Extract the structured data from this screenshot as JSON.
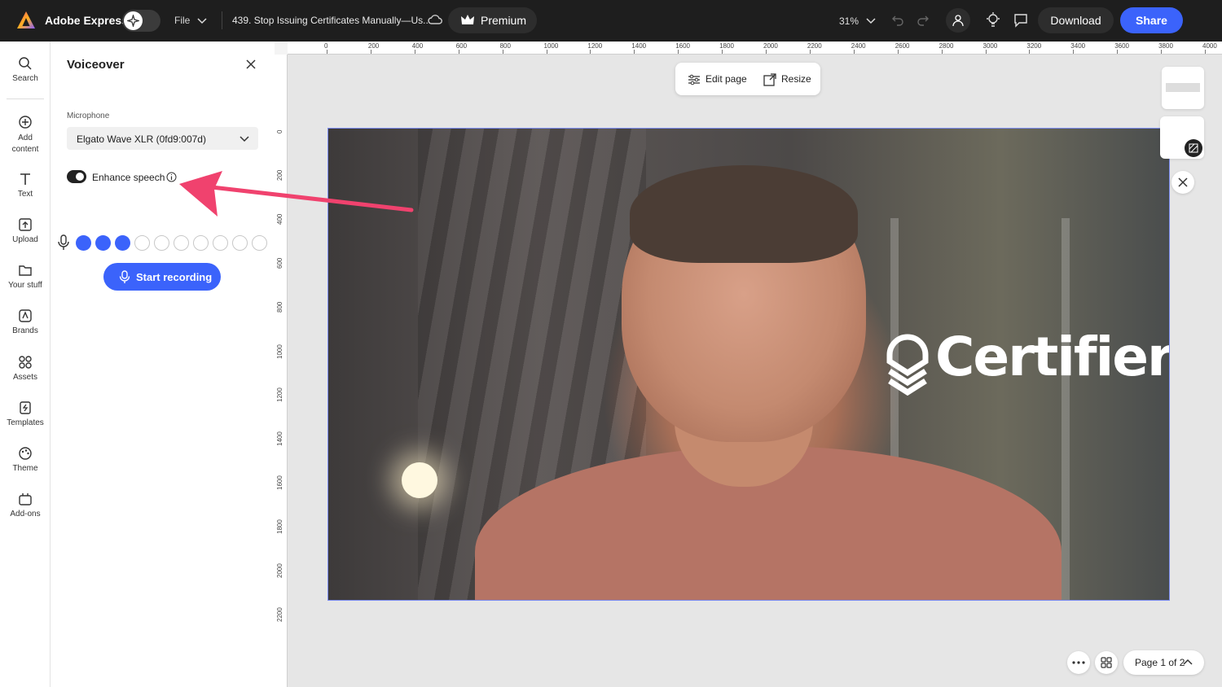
{
  "app": {
    "title": "Adobe Express",
    "file_menu": "File",
    "document_title": "439. Stop Issuing Certificates Manually—Us...",
    "premium_label": "Premium",
    "zoom": "31%",
    "download_label": "Download",
    "share_label": "Share"
  },
  "colors": {
    "accent": "#3b63fb",
    "topbar": "#1e1e1e",
    "annotation_arrow": "#f0426e"
  },
  "rail": {
    "items": [
      {
        "label": "Search",
        "icon": "search-icon"
      },
      {
        "label": "Add content",
        "icon": "plus-circle-icon"
      },
      {
        "label": "Text",
        "icon": "text-icon"
      },
      {
        "label": "Upload",
        "icon": "upload-icon"
      },
      {
        "label": "Your stuff",
        "icon": "folder-icon"
      },
      {
        "label": "Brands",
        "icon": "brand-icon"
      },
      {
        "label": "Assets",
        "icon": "assets-icon"
      },
      {
        "label": "Templates",
        "icon": "templates-icon"
      },
      {
        "label": "Theme",
        "icon": "palette-icon"
      },
      {
        "label": "Add-ons",
        "icon": "addons-icon"
      }
    ]
  },
  "panel": {
    "title": "Voiceover",
    "microphone_label": "Microphone",
    "microphone_value": "Elgato Wave XLR (0fd9:007d)",
    "enhance_label": "Enhance speech",
    "enhance_on": true,
    "level_active": 3,
    "level_total": 10,
    "record_label": "Start recording"
  },
  "rulers": {
    "h_ticks": [
      "0",
      "200",
      "400",
      "600",
      "800",
      "1000",
      "1200",
      "1400",
      "1600",
      "1800",
      "2000",
      "2200",
      "2400",
      "2600",
      "2800",
      "3000",
      "3200",
      "3400",
      "3600",
      "3800",
      "4000"
    ],
    "v_ticks": [
      "0",
      "200",
      "400",
      "600",
      "800",
      "1000",
      "1200",
      "1400",
      "1600",
      "1800",
      "2000",
      "2200"
    ]
  },
  "toolbar": {
    "edit_page": "Edit page",
    "resize": "Resize"
  },
  "canvas": {
    "brand_text": "Certifier"
  },
  "footer": {
    "page_indicator": "Page 1 of 2"
  }
}
